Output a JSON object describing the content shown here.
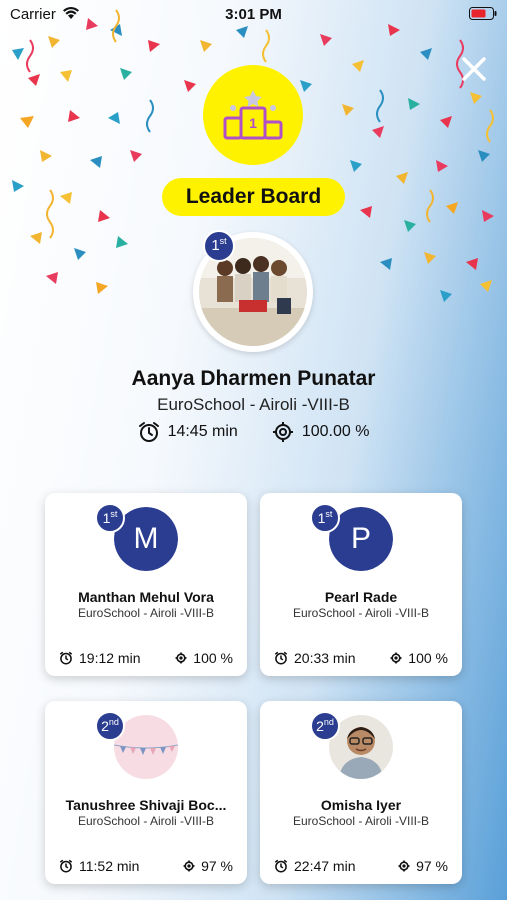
{
  "status_bar": {
    "carrier": "Carrier",
    "time": "3:01 PM"
  },
  "header": {
    "title": "Leader Board",
    "trophy_rank": "1"
  },
  "top_performer": {
    "rank": "1",
    "rank_suffix": "st",
    "name": "Aanya Dharmen Punatar",
    "school": "EuroSchool - Airoli -VIII-B",
    "time": "14:45 min",
    "accuracy": "100.00 %"
  },
  "cards": [
    {
      "rank": "1",
      "rank_suffix": "st",
      "initial": "M",
      "name": "Manthan Mehul Vora",
      "school": "EuroSchool - Airoli -VIII-B",
      "time": "19:12 min",
      "accuracy": "100 %"
    },
    {
      "rank": "1",
      "rank_suffix": "st",
      "initial": "P",
      "name": "Pearl Rade",
      "school": "EuroSchool - Airoli -VIII-B",
      "time": "20:33 min",
      "accuracy": "100 %"
    },
    {
      "rank": "2",
      "rank_suffix": "nd",
      "name": "Tanushree Shivaji Boc...",
      "school": "EuroSchool - Airoli -VIII-B",
      "time": "11:52 min",
      "accuracy": "97 %"
    },
    {
      "rank": "2",
      "rank_suffix": "nd",
      "name": "Omisha Iyer",
      "school": "EuroSchool - Airoli -VIII-B",
      "time": "22:47 min",
      "accuracy": "97 %"
    }
  ],
  "colors": {
    "accent_yellow": "#fff200",
    "badge_blue": "#2b3d91",
    "trophy_purple": "#b04fc9"
  }
}
